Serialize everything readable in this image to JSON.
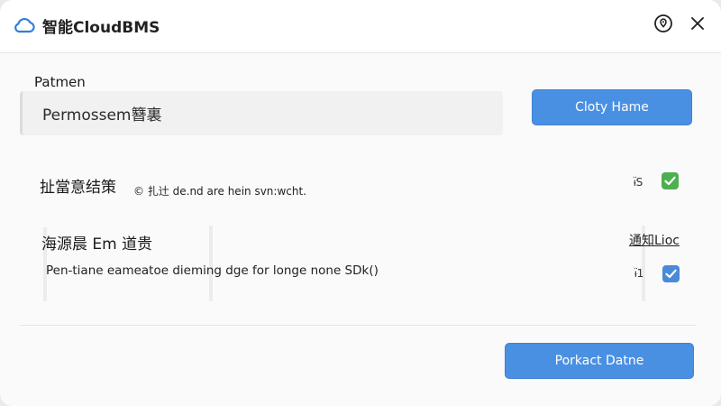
{
  "app": {
    "title": "智能CloudBMS",
    "logo_icon": "cloud-icon",
    "help_icon": "location-pin-icon",
    "close_icon": "close-icon"
  },
  "field": {
    "label": "Patmen",
    "value": "Permossem簪裏"
  },
  "buttons": {
    "top_label": "Cloty Hame",
    "bottom_label": "Porkact Datne"
  },
  "rows": [
    {
      "title": "扯當意结策",
      "description": "© 扎辻 de.nd are hein svn:wcht.",
      "count": "ᵼ̈S",
      "checked": true,
      "checkbox_color": "#4caf50"
    },
    {
      "title": "海源晨 Em 道贵",
      "description": "Pen-tiane eameatoe dieming dge for longe none SDk()",
      "count": "ᵼ̈1",
      "link": "通知Lioc",
      "checked": true,
      "checkbox_color": "#4a8ad8"
    }
  ],
  "colors": {
    "accent": "#4a90e2",
    "check_green": "#4caf50",
    "check_blue": "#4a8ad8"
  }
}
